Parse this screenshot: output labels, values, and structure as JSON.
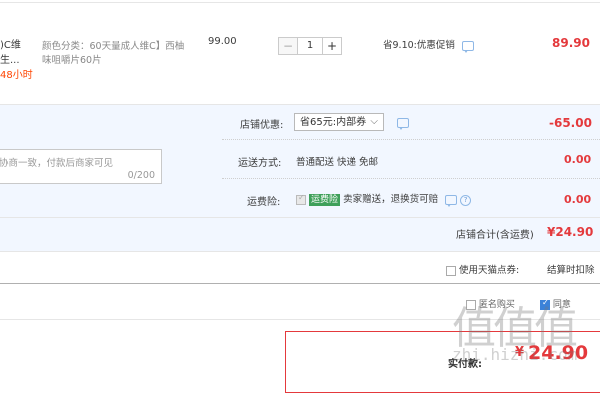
{
  "item": {
    "title_fragment": ")C维生...",
    "time_left": "48小时",
    "sku_line1": "颜色分类：60天量成人维C】西柚",
    "sku_line2": "味咀嚼片60片",
    "unit_price": "99.00",
    "qty_minus": "−",
    "qty_value": "1",
    "qty_plus": "+",
    "saving": "省9.10:优惠促销",
    "subtotal": "89.90"
  },
  "shop": {
    "discount_label": "店铺优惠:",
    "discount_select": "省65元:内部券",
    "discount_amount": "-65.00",
    "message_placeholder": "协商一致，付款后商家可见",
    "message_counter": "0/200",
    "shipping_label": "运送方式:",
    "shipping_value": "普通配送 快递 免邮",
    "shipping_amount": "0.00",
    "insurance_label": "运费险:",
    "insurance_badge": "运费险",
    "insurance_text": "卖家赠送，退换货可赔",
    "insurance_help": "?",
    "insurance_amount": "0.00",
    "total_label": "店铺合计(含运费)",
    "total_amount": "¥24.90"
  },
  "options": {
    "tmall_coupon_label": "使用天猫点券:",
    "settle_text": "结算时扣除",
    "anon_label": "匿名购买",
    "agree_label": "同意"
  },
  "pay": {
    "label": "实付款:",
    "currency": "¥",
    "amount": "24.90"
  },
  "watermark": {
    "big": "值值值",
    "small": "zhi.hizhi.com"
  },
  "colors": {
    "accent_red": "#e4393c",
    "link_blue": "#3b82d8",
    "row_blue": "#f2f7ff"
  }
}
